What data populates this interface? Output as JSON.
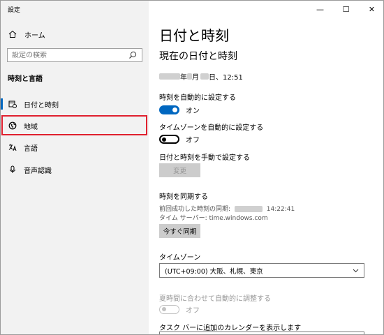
{
  "window": {
    "title": "設定"
  },
  "sidebar": {
    "home_label": "ホーム",
    "search_placeholder": "設定の検索",
    "section_title": "時刻と言語",
    "items": [
      {
        "label": "日付と時刻",
        "icon": "calendar-clock-icon",
        "selected": true
      },
      {
        "label": "地域",
        "icon": "globe-icon",
        "selected": false
      },
      {
        "label": "言語",
        "icon": "language-icon",
        "selected": false
      },
      {
        "label": "音声認識",
        "icon": "microphone-icon",
        "selected": false
      }
    ]
  },
  "caption_buttons": {
    "minimize": "—",
    "maximize": "☐",
    "close": "✕"
  },
  "main": {
    "title": "日付と時刻",
    "subtitle": "現在の日付と時刻",
    "current_datetime": {
      "year_suffix": "年",
      "month_suffix": "月",
      "day_time": "日、12:51"
    },
    "auto_time": {
      "label": "時刻を自動的に設定する",
      "state": "オン"
    },
    "auto_timezone": {
      "label": "タイムゾーンを自動的に設定する",
      "state": "オフ"
    },
    "manual": {
      "label": "日付と時刻を手動で設定する",
      "button": "変更"
    },
    "sync": {
      "heading": "時刻を同期する",
      "last_sync_label": "前回成功した時刻の同期:",
      "last_sync_time": "14:22:41",
      "server": "タイム サーバー: time.windows.com",
      "button": "今すぐ同期"
    },
    "timezone": {
      "label": "タイムゾーン",
      "value": "(UTC+09:00) 大阪、札幌、東京"
    },
    "dst": {
      "label": "夏時間に合わせて自動的に調整する",
      "state": "オフ"
    },
    "calendar_label": "タスク バーに追加のカレンダーを表示します"
  },
  "colors": {
    "accent": "#0067c0",
    "highlight_border": "#e0202e",
    "sidebar_bg": "#f2f2f2"
  }
}
